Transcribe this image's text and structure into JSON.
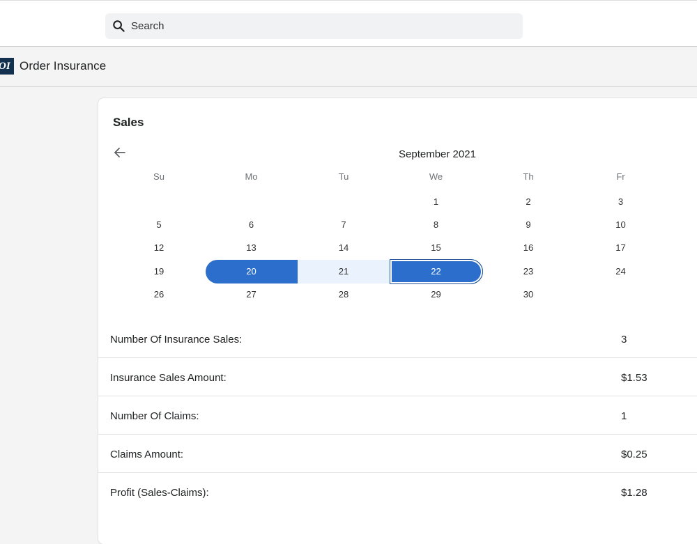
{
  "search": {
    "placeholder": "Search"
  },
  "app": {
    "logo_text": "OI",
    "title": "Order Insurance"
  },
  "card": {
    "title": "Sales"
  },
  "calendar": {
    "month": "September 2021",
    "weekdays": [
      "Su",
      "Mo",
      "Tu",
      "We",
      "Th",
      "Fr"
    ],
    "weeks": [
      [
        "",
        "",
        "",
        "1",
        "2",
        "3"
      ],
      [
        "5",
        "6",
        "7",
        "8",
        "9",
        "10"
      ],
      [
        "12",
        "13",
        "14",
        "15",
        "16",
        "17"
      ],
      [
        "19",
        "20",
        "21",
        "22",
        "23",
        "24"
      ],
      [
        "26",
        "27",
        "28",
        "29",
        "30",
        ""
      ]
    ],
    "selected_start": "20",
    "selected_end": "22",
    "accent_color": "#2c6ecb",
    "range_color": "#eaf2fd"
  },
  "stats": [
    {
      "label": "Number Of Insurance Sales:",
      "value": "3"
    },
    {
      "label": "Insurance Sales Amount:",
      "value": "$1.53"
    },
    {
      "label": "Number Of Claims:",
      "value": "1"
    },
    {
      "label": "Claims Amount:",
      "value": "$0.25"
    },
    {
      "label": "Profit (Sales-Claims):",
      "value": "$1.28"
    }
  ]
}
